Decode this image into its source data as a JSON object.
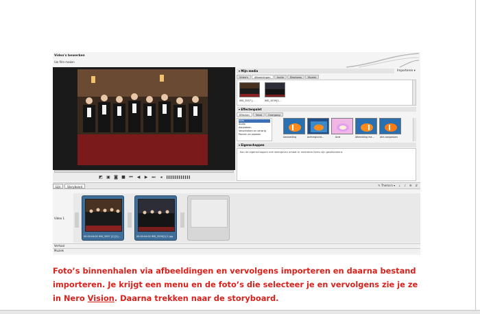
{
  "nero": {
    "header_title": "Video's bewerken",
    "header_subtitle": "Uw film maken",
    "media_panel": {
      "title": "Mijn media",
      "import_label": "Importeren",
      "tabs": [
        "Video's",
        "Afbeeldingen",
        "Audio",
        "Diashows",
        "Muziek"
      ],
      "active_tab": 1,
      "items": [
        "IMG_3557 [...",
        "IMG_3539[1..."
      ]
    },
    "effects_panel": {
      "title": "Effectenpalet",
      "tabs": [
        "Effecten",
        "Tekst",
        "Overgang"
      ],
      "categories": [
        "Alles",
        "Audio",
        "Aanpassen",
        "Verschieben en verwrig",
        "Pannen en zoomen"
      ],
      "selected_category": 0,
      "effects": [
        "Aanbieding",
        "Achtergrond...",
        "Acid",
        "Afbeelding ma...",
        "Alfa aanpassen"
      ]
    },
    "properties_panel": {
      "title": "Eigenschappen",
      "hint": "Kan de eigenschappen niet weergeven omdat er meerdere items zijn geselecteerd."
    },
    "timeline_tabs": [
      "Lijn",
      "Storyboard"
    ],
    "active_timeline_tab": 1,
    "themes_label": "Thema's",
    "track_labels": {
      "video": "Video 1",
      "narration": "Verhaal",
      "music": "Muziek"
    },
    "storyboard_clips": [
      {
        "label": "00:00:04:00 IMG_3557 [1] [1]...",
        "selected": true
      },
      {
        "label": "00:00:04:00 IMG_3539[1] 2.jpg",
        "selected": true
      },
      {
        "label": "",
        "selected": false
      }
    ]
  },
  "caption": {
    "part1": "Foto’s binnenhalen via afbeeldingen en vervolgens importeren en daarna bestand importeren. Je krijgt een menu en de foto’s die selecteer je en vervolgens zie je ze in Nero ",
    "link": "Vision",
    "part2": ". Daarna trekken naar de storyboard."
  },
  "colors": {
    "caption": "#d9211c",
    "storyboard_selected": "#3f6f99",
    "page_background": "#ffffff"
  }
}
